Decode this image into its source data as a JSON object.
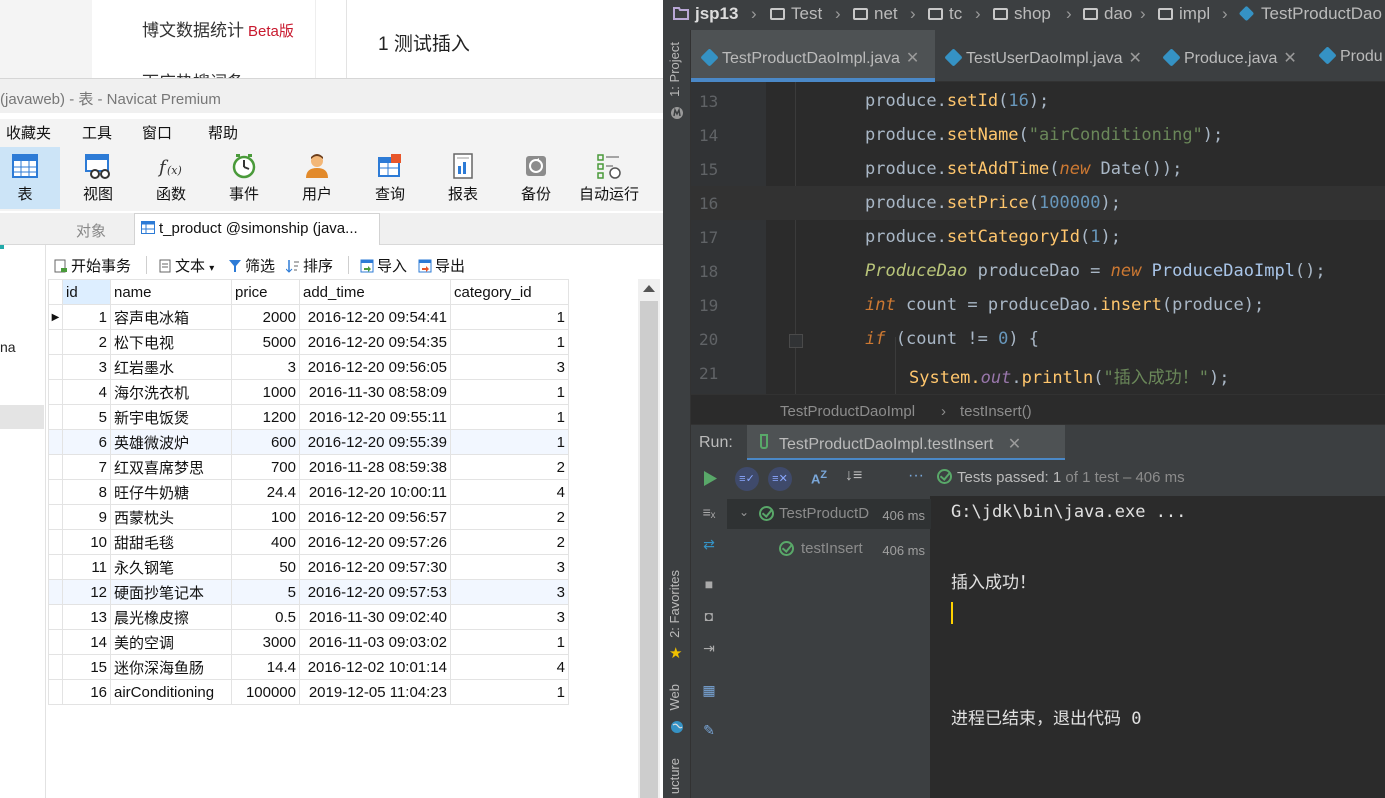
{
  "web": {
    "menu_stats": "博文数据统计",
    "menu_stats_badge": "Beta版",
    "menu_next": "下应热搜词条",
    "heading": "1  测试插入"
  },
  "navicat": {
    "title": "(javaweb) - 表 - Navicat Premium",
    "menu": [
      "收藏夹",
      "工具",
      "窗口",
      "帮助"
    ],
    "toolbar": [
      "表",
      "视图",
      "函数",
      "事件",
      "用户",
      "查询",
      "报表",
      "备份",
      "自动运行"
    ],
    "tabs": {
      "objects": "对象",
      "table": "t_product @simonship (java..."
    },
    "actions": {
      "begin": "开始事务",
      "text": "文本",
      "filter": "筛选",
      "sort": "排序",
      "import": "导入",
      "export": "导出"
    },
    "left_fragment": "na",
    "columns": [
      "id",
      "name",
      "price",
      "add_time",
      "category_id"
    ],
    "rows": [
      [
        "1",
        "容声电冰箱",
        "2000",
        "2016-12-20 09:54:41",
        "1"
      ],
      [
        "2",
        "松下电视",
        "5000",
        "2016-12-20 09:54:35",
        "1"
      ],
      [
        "3",
        "红岩墨水",
        "3",
        "2016-12-20 09:56:05",
        "3"
      ],
      [
        "4",
        "海尔洗衣机",
        "1000",
        "2016-11-30 08:58:09",
        "1"
      ],
      [
        "5",
        "新宇电饭煲",
        "1200",
        "2016-12-20 09:55:11",
        "1"
      ],
      [
        "6",
        "英雄微波炉",
        "600",
        "2016-12-20 09:55:39",
        "1"
      ],
      [
        "7",
        "红双喜席梦思",
        "700",
        "2016-11-28 08:59:38",
        "2"
      ],
      [
        "8",
        "旺仔牛奶糖",
        "24.4",
        "2016-12-20 10:00:11",
        "4"
      ],
      [
        "9",
        "西蒙枕头",
        "100",
        "2016-12-20 09:56:57",
        "2"
      ],
      [
        "10",
        "甜甜毛毯",
        "400",
        "2016-12-20 09:57:26",
        "2"
      ],
      [
        "11",
        "永久钢笔",
        "50",
        "2016-12-20 09:57:30",
        "3"
      ],
      [
        "12",
        "硬面抄笔记本",
        "5",
        "2016-12-20 09:57:53",
        "3"
      ],
      [
        "13",
        "晨光橡皮擦",
        "0.5",
        "2016-11-30 09:02:40",
        "3"
      ],
      [
        "14",
        "美的空调",
        "3000",
        "2016-11-03 09:03:02",
        "1"
      ],
      [
        "15",
        "迷你深海鱼肠",
        "14.4",
        "2016-12-02 10:01:14",
        "4"
      ],
      [
        "16",
        "airConditioning",
        "100000",
        "2019-12-05 11:04:23",
        "1"
      ]
    ]
  },
  "ide": {
    "breadcrumbs": [
      "jsp13",
      "Test",
      "net",
      "tc",
      "shop",
      "dao",
      "impl",
      "TestProductDao"
    ],
    "tabs": [
      "TestProductDaoImpl.java",
      "TestUserDaoImpl.java",
      "Produce.java",
      "Produ"
    ],
    "side_labels": {
      "project": "1: Project",
      "favorites": "2: Favorites",
      "web": "Web",
      "structure": "ucture"
    },
    "line_numbers": [
      "13",
      "14",
      "15",
      "16",
      "17",
      "18",
      "19",
      "20",
      "21"
    ],
    "code": {
      "l13": {
        "obj": "produce.",
        "m": "setId",
        "open": "(",
        "arg": "16",
        "close": ");"
      },
      "l14": {
        "obj": "produce.",
        "m": "setName",
        "open": "(",
        "arg": "\"airConditioning\"",
        "close": ");"
      },
      "l15": {
        "obj": "produce.",
        "m": "setAddTime",
        "open": "(",
        "kw": "new",
        "sp": " ",
        "cls": "Date",
        "close": "());"
      },
      "l16": {
        "obj": "produce.",
        "m": "setPrice",
        "open": "(",
        "arg": "100000",
        "close": ");"
      },
      "l17": {
        "obj": "produce.",
        "m": "setCategoryId",
        "open": "(",
        "arg": "1",
        "close": ");"
      },
      "l18": {
        "type": "ProduceDao",
        "mid": " produceDao = ",
        "kw": "new",
        "sp": " ",
        "cls": "ProduceDaoImpl",
        "close": "();"
      },
      "l19": {
        "kw": "int",
        "mid": " count = produceDao.",
        "m": "insert",
        "close": "(produce);"
      },
      "l20": {
        "kw": "if",
        "mid": " (count != ",
        "arg": "0",
        "close": ") {"
      },
      "l21": {
        "sys": "System.",
        "field": "out",
        "dot": ".",
        "m": "println",
        "open": "(",
        "arg": "\"插入成功！\"",
        "close": ");"
      }
    },
    "editor_breadcrumb": [
      "TestProductDaoImpl",
      "testInsert()"
    ],
    "run": {
      "label": "Run:",
      "tab": "TestProductDaoImpl.testInsert",
      "tests_passed": "Tests passed:",
      "tests_count": "1",
      "tests_rest": "of 1 test – 406 ms",
      "tree": [
        {
          "name": "TestProductD",
          "time": "406 ms"
        },
        {
          "name": "testInsert",
          "time": "406 ms"
        }
      ],
      "console": [
        "G:\\jdk\\bin\\java.exe ...",
        "插入成功！",
        "进程已结束，退出代码 0"
      ]
    }
  }
}
